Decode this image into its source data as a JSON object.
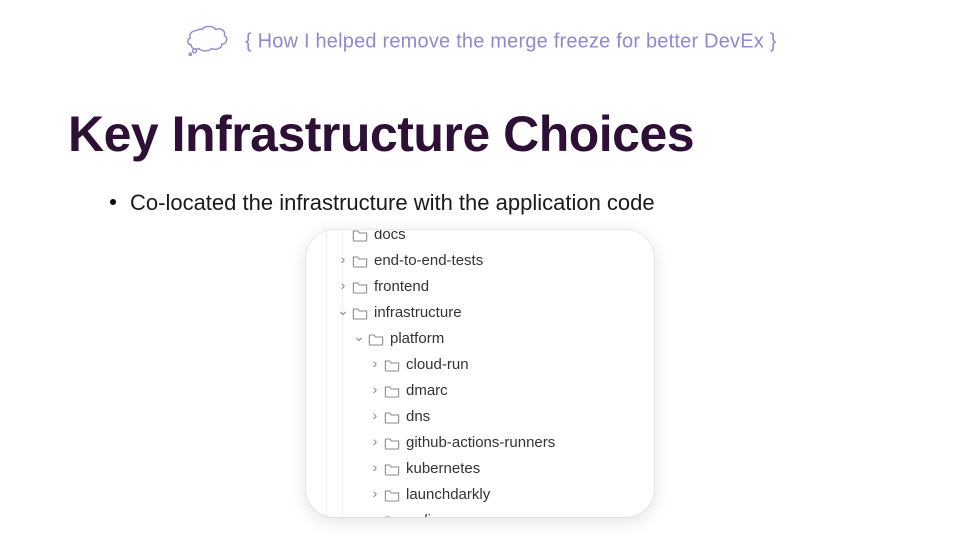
{
  "header": {
    "text": "{ How I helped remove the merge freeze for better DevEx }"
  },
  "title": "Key Infrastructure Choices",
  "bullet": "Co-located the infrastructure with the application code",
  "tree": {
    "items": [
      {
        "indent": 1,
        "chev": "none",
        "label": "docs",
        "cut": "top"
      },
      {
        "indent": 1,
        "chev": "closed",
        "label": "end-to-end-tests"
      },
      {
        "indent": 1,
        "chev": "closed",
        "label": "frontend"
      },
      {
        "indent": 1,
        "chev": "open",
        "label": "infrastructure"
      },
      {
        "indent": 2,
        "chev": "open",
        "label": "platform"
      },
      {
        "indent": 3,
        "chev": "closed",
        "label": "cloud-run"
      },
      {
        "indent": 3,
        "chev": "closed",
        "label": "dmarc"
      },
      {
        "indent": 3,
        "chev": "closed",
        "label": "dns"
      },
      {
        "indent": 3,
        "chev": "closed",
        "label": "github-actions-runners"
      },
      {
        "indent": 3,
        "chev": "closed",
        "label": "kubernetes"
      },
      {
        "indent": 3,
        "chev": "closed",
        "label": "launchdarkly"
      },
      {
        "indent": 3,
        "chev": "closed",
        "label": "redis",
        "cut": "bottom"
      }
    ]
  }
}
